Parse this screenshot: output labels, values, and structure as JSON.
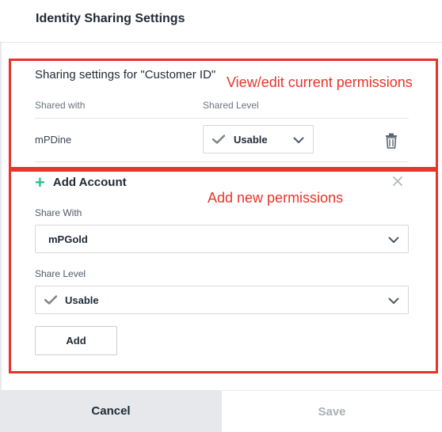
{
  "header": {
    "title": "Identity Sharing Settings"
  },
  "current": {
    "title": "Sharing settings for \"Customer ID\"",
    "col_shared_with": "Shared with",
    "col_shared_level": "Shared Level",
    "rows": [
      {
        "account": "mPDine",
        "level": "Usable"
      }
    ]
  },
  "add": {
    "title": "Add Account",
    "share_with_label": "Share With",
    "share_with_value": "mPGold",
    "share_level_label": "Share Level",
    "share_level_value": "Usable",
    "add_button": "Add"
  },
  "annotations": {
    "current_note": "View/edit current permissions",
    "add_note": "Add new permissions",
    "color": "#e8342a"
  },
  "footer": {
    "cancel": "Cancel",
    "save": "Save"
  },
  "icons": [
    "check-icon",
    "chevron-down-icon",
    "trash-icon",
    "plus-icon",
    "close-icon"
  ],
  "colors": {
    "accent_plus": "#2fbf8f",
    "cancel_bg": "#e6e8eb",
    "save_text_disabled": "#a9b0b8"
  }
}
